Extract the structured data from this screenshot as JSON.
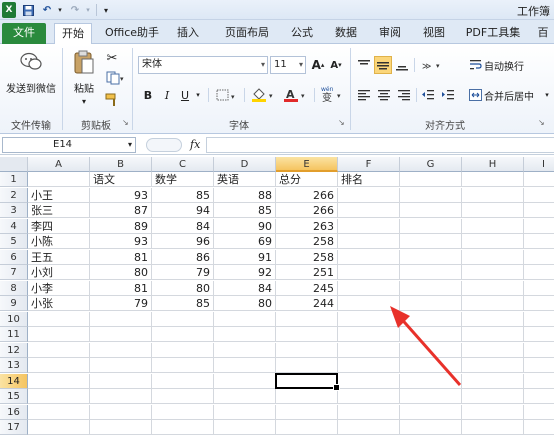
{
  "window": {
    "title": "工作簿"
  },
  "quick_access": {
    "save_icon": "save-icon",
    "undo_icon": "undo-icon",
    "redo_icon": "redo-icon",
    "customize_icon": "customize-icon"
  },
  "tabs": [
    {
      "label": "文件"
    },
    {
      "label": "开始"
    },
    {
      "label": "Office助手"
    },
    {
      "label": "插入"
    },
    {
      "label": "页面布局"
    },
    {
      "label": "公式"
    },
    {
      "label": "数据"
    },
    {
      "label": "审阅"
    },
    {
      "label": "视图"
    },
    {
      "label": "PDF工具集"
    },
    {
      "label": "百"
    }
  ],
  "ribbon": {
    "transfer": {
      "send_wechat": "发送到微信",
      "group": "文件传输"
    },
    "clipboard": {
      "paste": "粘贴",
      "group": "剪贴板"
    },
    "font": {
      "name": "宋体",
      "size": "11",
      "grow": "A",
      "shrink": "A",
      "bold": "B",
      "italic": "I",
      "underline": "U",
      "wen": "变",
      "group": "字体"
    },
    "alignment": {
      "wrap": "自动换行",
      "merge": "合并后居中",
      "group": "对齐方式"
    }
  },
  "formula_bar": {
    "name_box": "E14",
    "fx": "fx",
    "content": ""
  },
  "columns": [
    "A",
    "B",
    "C",
    "D",
    "E",
    "F",
    "G",
    "H",
    "I"
  ],
  "rows": [
    "1",
    "2",
    "3",
    "4",
    "5",
    "6",
    "7",
    "8",
    "9",
    "10",
    "11",
    "12",
    "13",
    "14",
    "15",
    "16",
    "17"
  ],
  "selected": {
    "column": "E",
    "row": "14"
  },
  "sheet": {
    "headers": [
      "",
      "语文",
      "数学",
      "英语",
      "总分",
      "排名"
    ],
    "data": [
      [
        "小王",
        "93",
        "85",
        "88",
        "266"
      ],
      [
        "张三",
        "87",
        "94",
        "85",
        "266"
      ],
      [
        "李四",
        "89",
        "84",
        "90",
        "263"
      ],
      [
        "小陈",
        "93",
        "96",
        "69",
        "258"
      ],
      [
        "王五",
        "81",
        "86",
        "91",
        "258"
      ],
      [
        "小刘",
        "80",
        "79",
        "92",
        "251"
      ],
      [
        "小李",
        "81",
        "80",
        "84",
        "245"
      ],
      [
        "小张",
        "79",
        "85",
        "80",
        "244"
      ]
    ]
  },
  "colors": {
    "file_tab": "#2a8a3d",
    "arrow": "#e8312a",
    "selection": "#f5c460"
  }
}
